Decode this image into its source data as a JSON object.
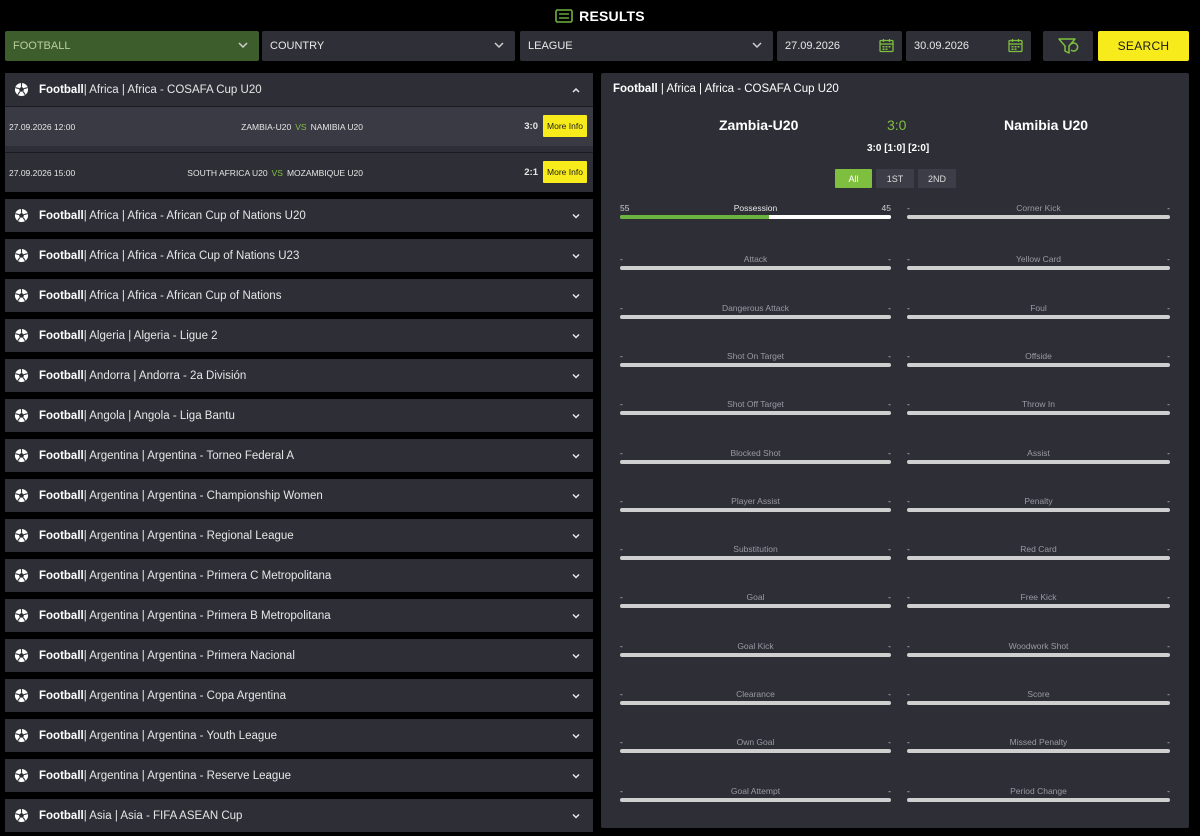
{
  "header": {
    "title": "RESULTS",
    "icon": "ticket-icon"
  },
  "filters": {
    "sport": "FOOTBALL",
    "country": "COUNTRY",
    "league": "LEAGUE",
    "date_from": "27.09.2026",
    "date_to": "30.09.2026",
    "search_label": "SEARCH"
  },
  "left": {
    "open_league": {
      "sport": "Football",
      "rest": " | Africa | Africa - COSAFA Cup U20",
      "matches": [
        {
          "time": "27.09.2026 12:00",
          "home": "ZAMBIA-U20",
          "vs": "VS",
          "away": "NAMIBIA U20",
          "score": "3:0",
          "more": "More Info"
        },
        {
          "time": "27.09.2026 15:00",
          "home": "SOUTH AFRICA U20",
          "vs": "VS",
          "away": "MOZAMBIQUE U20",
          "score": "2:1",
          "more": "More Info"
        }
      ]
    },
    "leagues": [
      {
        "sport": "Football",
        "rest": " | Africa | Africa - African Cup of Nations U20"
      },
      {
        "sport": "Football",
        "rest": " | Africa | Africa - Africa Cup of Nations U23"
      },
      {
        "sport": "Football",
        "rest": " | Africa | Africa - African Cup of Nations"
      },
      {
        "sport": "Football",
        "rest": " | Algeria | Algeria - Ligue 2"
      },
      {
        "sport": "Football",
        "rest": " | Andorra | Andorra - 2a División"
      },
      {
        "sport": "Football",
        "rest": " | Angola | Angola - Liga Bantu"
      },
      {
        "sport": "Football",
        "rest": " | Argentina | Argentina - Torneo Federal A"
      },
      {
        "sport": "Football",
        "rest": " | Argentina | Argentina - Championship Women"
      },
      {
        "sport": "Football",
        "rest": " | Argentina | Argentina - Regional League"
      },
      {
        "sport": "Football",
        "rest": " | Argentina | Argentina - Primera C Metropolitana"
      },
      {
        "sport": "Football",
        "rest": " | Argentina | Argentina - Primera B Metropolitana"
      },
      {
        "sport": "Football",
        "rest": " | Argentina | Argentina - Primera Nacional"
      },
      {
        "sport": "Football",
        "rest": " | Argentina | Argentina - Copa Argentina"
      },
      {
        "sport": "Football",
        "rest": " | Argentina | Argentina - Youth League"
      },
      {
        "sport": "Football",
        "rest": " | Argentina | Argentina - Reserve League"
      },
      {
        "sport": "Football",
        "rest": " | Asia | Asia - FIFA ASEAN Cup"
      }
    ]
  },
  "detail": {
    "sport": "Football",
    "rest": " | Africa | Africa - COSAFA Cup U20",
    "home": "Zambia-U20",
    "away": "Namibia U20",
    "score": "3:0",
    "score_detail": "3:0 [1:0] [2:0]",
    "tabs": [
      "All",
      "1ST",
      "2ND"
    ],
    "active_tab": "All",
    "possession": {
      "name": "Possession",
      "home": "55",
      "away": "45",
      "home_fraction": 0.55
    },
    "stats_left": [
      "Attack",
      "Dangerous Attack",
      "Shot On Target",
      "Shot Off Target",
      "Blocked Shot",
      "Player Assist",
      "Substitution",
      "Goal",
      "Goal Kick",
      "Clearance",
      "Own Goal",
      "Goal Attempt"
    ],
    "stats_right": [
      "Corner Kick",
      "Yellow Card",
      "Foul",
      "Offside",
      "Throw In",
      "Assist",
      "Penalty",
      "Red Card",
      "Free Kick",
      "Woodwork Shot",
      "Score",
      "Missed Penalty",
      "Period Change"
    ],
    "empty_value": "-"
  },
  "colors": {
    "accent_yellow": "#f8eb1c",
    "accent_green": "#7fbf3f",
    "panel": "#2e2e37"
  }
}
